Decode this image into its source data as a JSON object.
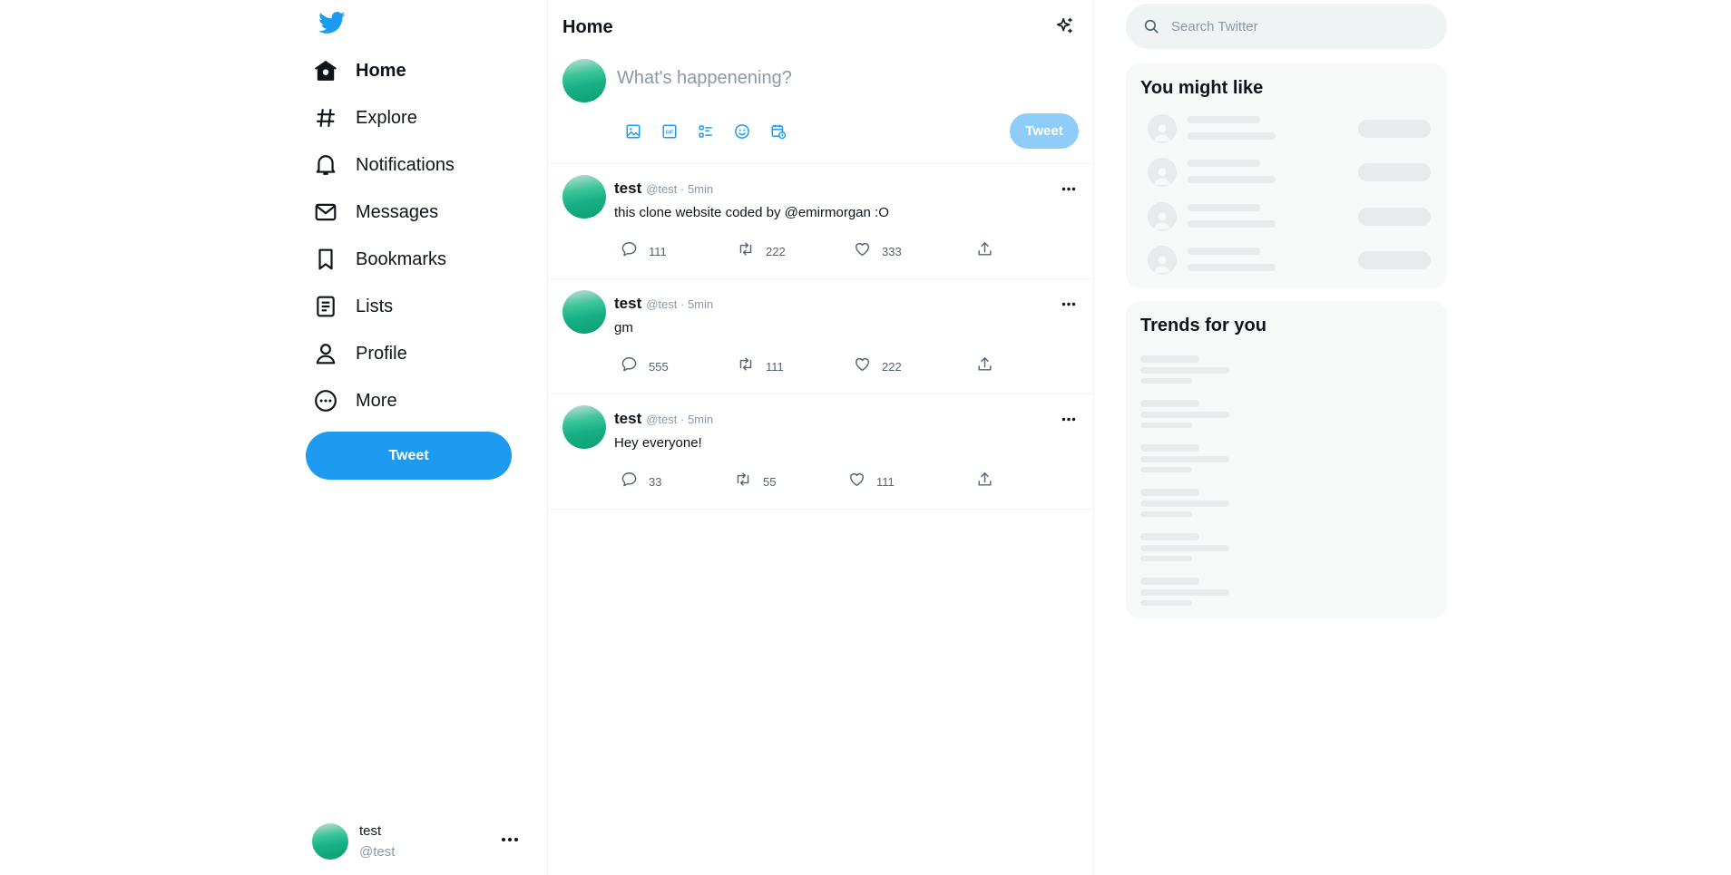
{
  "sidebar": {
    "logo": "twitter-bird-icon",
    "nav": [
      {
        "label": "Home",
        "icon": "home-icon",
        "active": true
      },
      {
        "label": "Explore",
        "icon": "hashtag-icon",
        "active": false
      },
      {
        "label": "Notifications",
        "icon": "bell-icon",
        "active": false
      },
      {
        "label": "Messages",
        "icon": "envelope-icon",
        "active": false
      },
      {
        "label": "Bookmarks",
        "icon": "bookmark-icon",
        "active": false
      },
      {
        "label": "Lists",
        "icon": "list-icon",
        "active": false
      },
      {
        "label": "Profile",
        "icon": "person-icon",
        "active": false
      },
      {
        "label": "More",
        "icon": "more-circle-icon",
        "active": false
      }
    ],
    "tweet_button": "Tweet",
    "account": {
      "name": "test",
      "handle": "@test"
    }
  },
  "main": {
    "title": "Home",
    "composer": {
      "placeholder": "What's happenening?",
      "tweet_button": "Tweet",
      "tools": [
        "image-icon",
        "gif-icon",
        "poll-icon",
        "emoji-icon",
        "schedule-icon"
      ]
    },
    "tweets": [
      {
        "name": "test",
        "meta": "@test · 5min",
        "text": "this clone website coded by @emirmorgan :O",
        "replies": "111",
        "retweets": "222",
        "likes": "333"
      },
      {
        "name": "test",
        "meta": "@test · 5min",
        "text": "gm",
        "replies": "555",
        "retweets": "111",
        "likes": "222"
      },
      {
        "name": "test",
        "meta": "@test · 5min",
        "text": "Hey everyone!",
        "replies": "33",
        "retweets": "55",
        "likes": "111"
      }
    ]
  },
  "right": {
    "search_placeholder": "Search Twitter",
    "you_might_like_title": "You might like",
    "trends_title": "Trends for you"
  },
  "colors": {
    "accent": "#1d9bf0",
    "accent_disabled": "#8ecdf8",
    "panel_bg": "#f7f9f9",
    "skeleton": "#e8eaec"
  }
}
